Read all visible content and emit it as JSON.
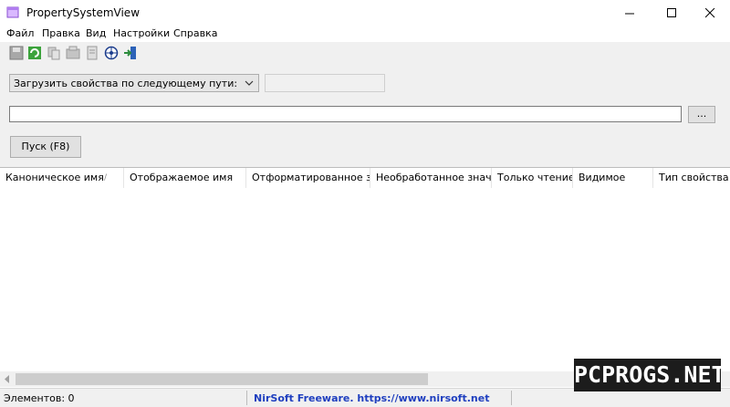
{
  "window": {
    "title": "PropertySystemView"
  },
  "menu": [
    "Файл",
    "Правка",
    "Вид",
    "Настройки",
    "Справка"
  ],
  "toolbar": [
    "save-icon",
    "refresh-icon",
    "copy-icon",
    "properties-icon",
    "html-report-icon",
    "find-icon",
    "exit-icon"
  ],
  "controls": {
    "load_mode": "Загрузить свойства по следующему пути:",
    "path_value": "",
    "browse_label": "...",
    "run_label": "Пуск (F8)"
  },
  "columns": [
    "Каноническое имя",
    "Отображаемое имя",
    "Отформатированное з...",
    "Необработанное значе...",
    "Только чтение",
    "Видимое",
    "Тип свойства"
  ],
  "status": {
    "items_text": "Элементов: 0",
    "link_text": "NirSoft Freeware. https://www.nirsoft.net"
  },
  "watermark": "PCPROGS.NET",
  "colors": {
    "link": "#1f3fbf",
    "window_bg": "#f0f0f0"
  }
}
